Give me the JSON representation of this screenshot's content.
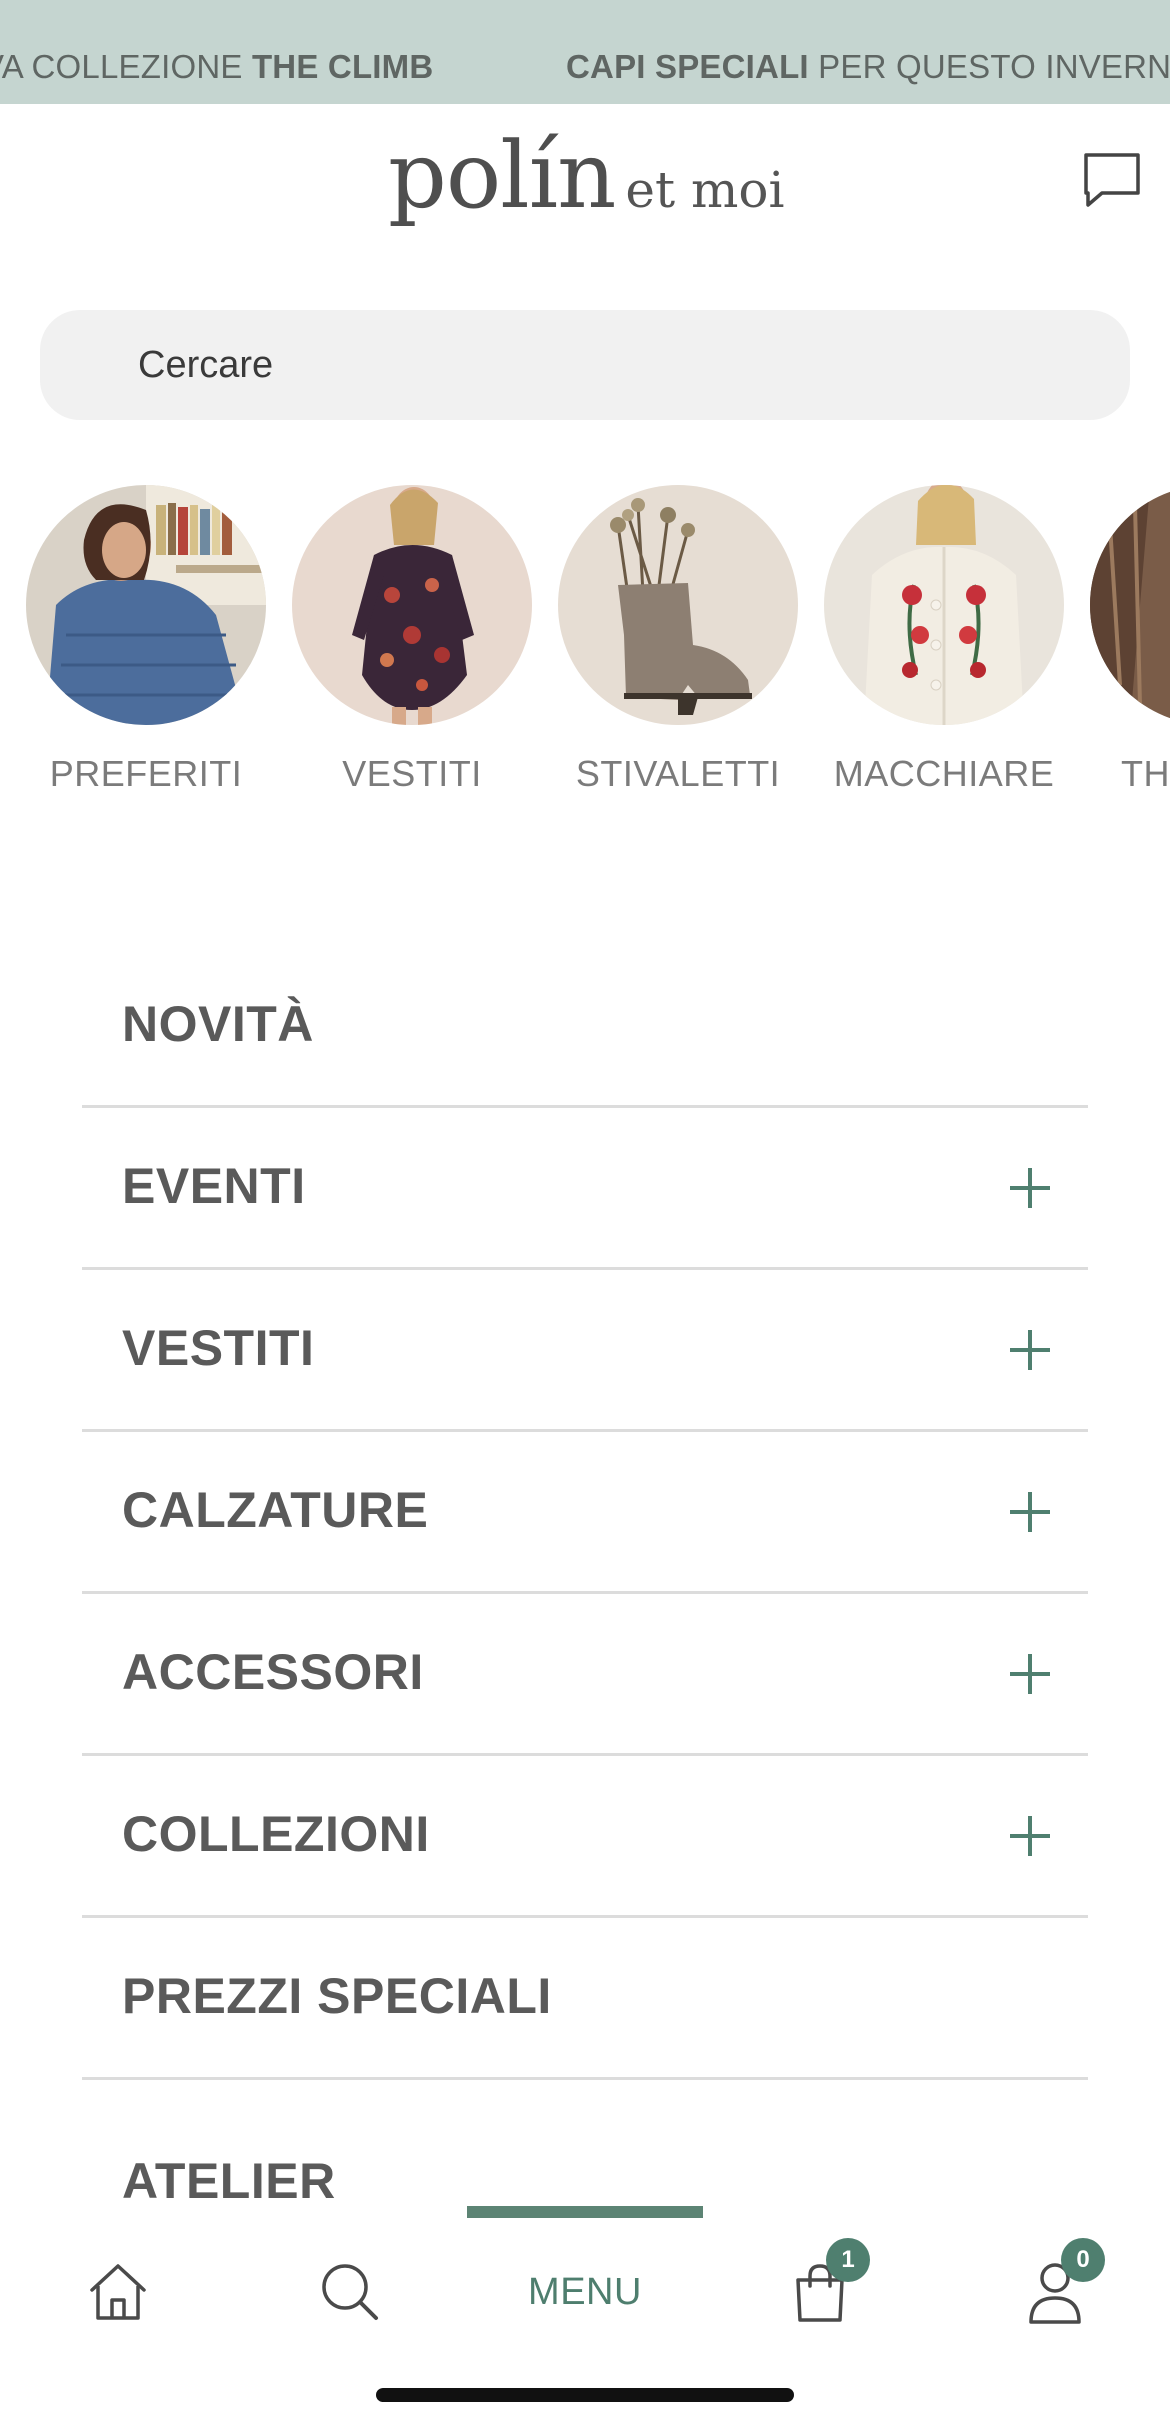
{
  "announcement": {
    "item1_prefix": "VA COLLEZIONE ",
    "item1_bold": "THE CLIMB",
    "item2_bold": "CAPI SPECIALI",
    "item2_suffix": " PER QUESTO INVERNO"
  },
  "header": {
    "logo_main": "polín",
    "logo_sub": "et moi",
    "chat_icon": "chat-bubble-icon"
  },
  "search": {
    "placeholder": "Cercare"
  },
  "categories": [
    {
      "label": "PREFERITI"
    },
    {
      "label": "VESTITI"
    },
    {
      "label": "STIVALETTI"
    },
    {
      "label": "MACCHIARE"
    },
    {
      "label": "TH"
    }
  ],
  "menu": {
    "items": [
      {
        "label": "NOVITÀ",
        "expandable": false
      },
      {
        "label": "EVENTI",
        "expandable": true
      },
      {
        "label": "VESTITI",
        "expandable": true
      },
      {
        "label": "CALZATURE",
        "expandable": true
      },
      {
        "label": "ACCESSORI",
        "expandable": true
      },
      {
        "label": "COLLEZIONI",
        "expandable": true
      },
      {
        "label": "PREZZI SPECIALI",
        "expandable": false
      },
      {
        "label": "ATELIER",
        "expandable": false
      }
    ]
  },
  "bottom_nav": {
    "menu_label": "MENU",
    "cart_count": "1",
    "account_count": "0",
    "active": "menu"
  },
  "colors": {
    "announcement_bg": "#c5d5d0",
    "accent": "#4f7f6f",
    "search_bg": "#f1f1f1"
  }
}
